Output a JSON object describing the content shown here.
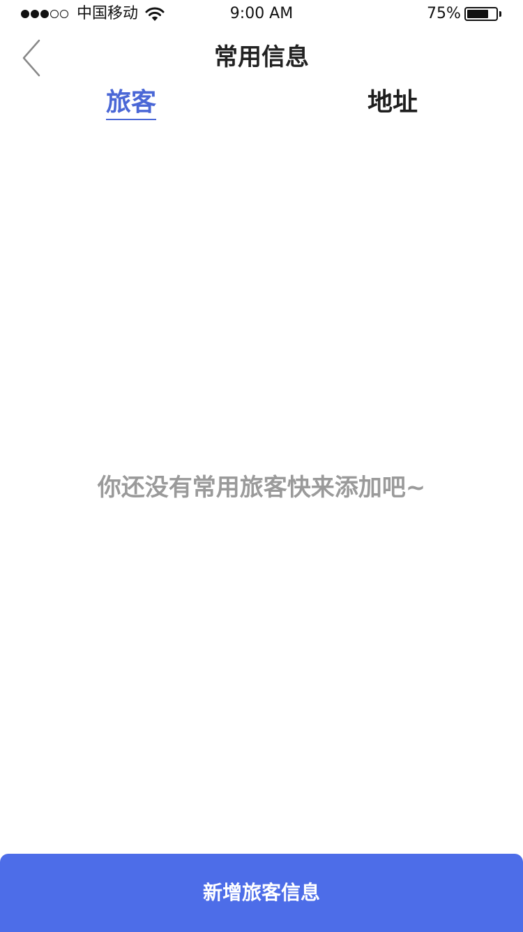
{
  "status_bar": {
    "signal_strength": 3,
    "signal_max": 5,
    "carrier": "中国移动",
    "wifi_icon": "wifi-icon",
    "time": "9:00 AM",
    "battery_percent_label": "75%",
    "battery_level": 0.75
  },
  "nav": {
    "back_icon": "chevron-left-icon",
    "title": "常用信息"
  },
  "tabs": [
    {
      "label": "旅客",
      "active": true
    },
    {
      "label": "地址",
      "active": false
    }
  ],
  "empty_state": {
    "message": "你还没有常用旅客快来添加吧~"
  },
  "footer": {
    "add_button_label": "新增旅客信息"
  },
  "colors": {
    "accent": "#4a67d6",
    "button": "#4d6de8",
    "muted_text": "#9a9a9a"
  }
}
